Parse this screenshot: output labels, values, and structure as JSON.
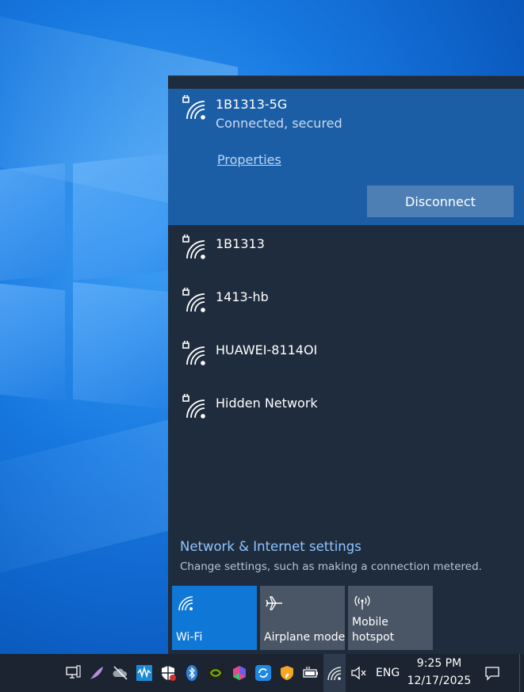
{
  "wifi_flyout": {
    "connected": {
      "ssid": "1B1313-5G",
      "status": "Connected, secured",
      "properties_label": "Properties",
      "disconnect_label": "Disconnect",
      "icon": "wifi-secured-icon"
    },
    "networks": [
      {
        "ssid": "1B1313",
        "icon": "wifi-secured-icon"
      },
      {
        "ssid": "1413-hb",
        "icon": "wifi-secured-icon"
      },
      {
        "ssid": "HUAWEI-8114OI",
        "icon": "wifi-secured-icon"
      },
      {
        "ssid": "Hidden Network",
        "icon": "wifi-secured-icon"
      }
    ],
    "settings_title": "Network & Internet settings",
    "settings_desc": "Change settings, such as making a connection metered.",
    "quick_actions": [
      {
        "label": "Wi-Fi",
        "active": true,
        "icon": "wifi-icon"
      },
      {
        "label": "Airplane mode",
        "active": false,
        "icon": "airplane-icon"
      },
      {
        "label": "Mobile\nhotspot",
        "active": false,
        "icon": "hotspot-icon"
      }
    ]
  },
  "taskbar": {
    "language": "ENG",
    "time": "9:25 PM",
    "date": "12/17/2025",
    "tray_icons": [
      "network-computer-icon",
      "feather-icon",
      "cloud-offline-icon",
      "audio-wave-icon",
      "shield-icon",
      "bluetooth-icon",
      "nvidia-icon",
      "office-icon",
      "sync-icon",
      "security-shield-icon",
      "battery-icon",
      "wifi-icon",
      "mute-speaker-icon",
      "notifications-icon"
    ]
  },
  "colors": {
    "flyout_bg": "#1f2c3d",
    "connected_bg": "#1c5ea6",
    "accent": "#0f78d7",
    "link": "#8fc5ff",
    "taskbar_bg": "#1b2430"
  }
}
